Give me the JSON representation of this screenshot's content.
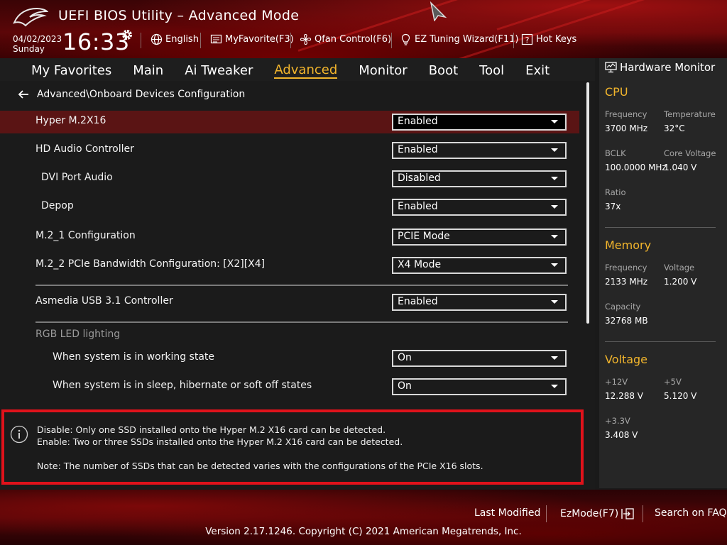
{
  "header": {
    "title": "UEFI BIOS Utility – Advanced Mode",
    "date": "04/02/2023",
    "day": "Sunday",
    "time": "16:33",
    "links": [
      {
        "label": "English",
        "icon": "globe-icon"
      },
      {
        "label": "MyFavorite(F3)",
        "icon": "favorite-list-icon"
      },
      {
        "label": "Qfan Control(F6)",
        "icon": "fan-icon"
      },
      {
        "label": "EZ Tuning Wizard(F11)",
        "icon": "lightbulb-icon"
      },
      {
        "label": "Hot Keys",
        "icon": "question-icon"
      }
    ]
  },
  "nav": {
    "tabs": [
      "My Favorites",
      "Main",
      "Ai Tweaker",
      "Advanced",
      "Monitor",
      "Boot",
      "Tool",
      "Exit"
    ],
    "active": "Advanced"
  },
  "main": {
    "breadcrumb": "Advanced\\Onboard Devices Configuration",
    "settings": [
      {
        "label": "Hyper M.2X16",
        "value": "Enabled"
      },
      {
        "label": "HD Audio Controller",
        "value": "Enabled"
      },
      {
        "label": "DVI Port Audio",
        "value": "Disabled"
      },
      {
        "label": "Depop",
        "value": "Enabled"
      },
      {
        "label": "M.2_1 Configuration",
        "value": "PCIE Mode"
      },
      {
        "label": "M.2_2 PCIe Bandwidth Configuration: [X2][X4]",
        "value": "X4 Mode"
      },
      {
        "label": "Asmedia USB 3.1 Controller",
        "value": "Enabled"
      },
      {
        "label": "When system is in working state",
        "value": "On"
      },
      {
        "label": "When system is in sleep, hibernate or soft off states",
        "value": "On"
      }
    ],
    "rgb_heading": "RGB LED lighting"
  },
  "info": {
    "line1": "Disable: Only one SSD installed onto the Hyper M.2 X16 card can be detected.",
    "line2": "Enable: Two or three SSDs installed onto the Hyper M.2 X16 card can be detected.",
    "line3": "Note: The number of SSDs that can be detected varies with the configurations of the PCIe X16 slots."
  },
  "hw_monitor": {
    "title": "Hardware Monitor",
    "cpu": {
      "heading": "CPU",
      "frequency_label": "Frequency",
      "frequency": "3700 MHz",
      "temperature_label": "Temperature",
      "temperature": "32°C",
      "bclk_label": "BCLK",
      "bclk": "100.0000 MHz",
      "core_voltage_label": "Core Voltage",
      "core_voltage": "1.040 V",
      "ratio_label": "Ratio",
      "ratio": "37x"
    },
    "memory": {
      "heading": "Memory",
      "frequency_label": "Frequency",
      "frequency": "2133 MHz",
      "voltage_label": "Voltage",
      "voltage": "1.200 V",
      "capacity_label": "Capacity",
      "capacity": "32768 MB"
    },
    "voltage": {
      "heading": "Voltage",
      "v12_label": "+12V",
      "v12": "12.288 V",
      "v5_label": "+5V",
      "v5": "5.120 V",
      "v33_label": "+3.3V",
      "v33": "3.408 V"
    }
  },
  "footer": {
    "last_modified": "Last Modified",
    "ezmode": "EzMode(F7)",
    "search_faq": "Search on FAQ",
    "copyright": "Version 2.17.1246. Copyright (C) 2021 American Megatrends, Inc."
  },
  "colors": {
    "accent": "#f2b52c",
    "highlight_border": "#e0121b",
    "selected_row": "#5a1414"
  }
}
